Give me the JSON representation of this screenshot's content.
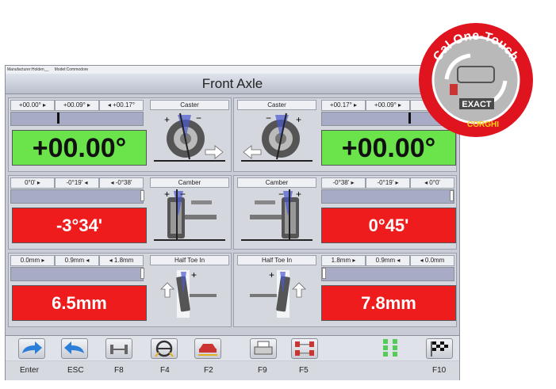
{
  "window": {
    "manufacturer": "Manufacturer:Holden__",
    "model": "Model:Commodore",
    "title": "Front Axle"
  },
  "rows": [
    {
      "label_left": "Caster",
      "label_right": "Caster",
      "left": {
        "scale": [
          "+00.00° ▸",
          "+00.09° ▸",
          "◂ +00.17°"
        ],
        "value": "+00.00°"
      },
      "right": {
        "scale": [
          "+00.17° ▸",
          "+00.09° ▸",
          "◂ +"
        ],
        "value": "+00.00°"
      }
    },
    {
      "label_left": "Camber",
      "label_right": "Camber",
      "left": {
        "scale": [
          "0°0' ▸",
          "-0°19' ◂",
          "◂ -0°38'"
        ],
        "value": "-3°34'"
      },
      "right": {
        "scale": [
          "-0°38' ▸",
          "-0°19' ▸",
          "◂ 0°0'"
        ],
        "value": "0°45'"
      }
    },
    {
      "label_left": "Half Toe In",
      "label_right": "Half Toe In",
      "left": {
        "scale": [
          "0.0mm ▸",
          "0.9mm ◂",
          "◂ 1.8mm"
        ],
        "value": "6.5mm"
      },
      "right": {
        "scale": [
          "1.8mm ▸",
          "0.9mm ◂",
          "◂ 0.0mm"
        ],
        "value": "7.8mm"
      }
    }
  ],
  "toolbar": {
    "keys": [
      "Enter",
      "ESC",
      "F8",
      "F4",
      "F2",
      "F9",
      "F5",
      "F10"
    ]
  },
  "badge": {
    "top_text": "Cal One-Touch",
    "center_text": "EXACT",
    "bottom_text": "CORGHI"
  },
  "colors": {
    "ok_green": "#6be34a",
    "error_red": "#ee1c1c",
    "badge_red": "#e0141e",
    "arrow_blue": "#2b7fd8"
  },
  "icons": [
    "caster-wheel-icon",
    "camber-wheel-icon",
    "toe-wheel-icon",
    "enter-arrow-icon",
    "esc-arrow-icon",
    "axle-icon",
    "steering-wheel-icon",
    "car-lift-icon",
    "printer-icon",
    "wheels-layout-icon",
    "sensors-icon",
    "checkered-flag-icon"
  ]
}
